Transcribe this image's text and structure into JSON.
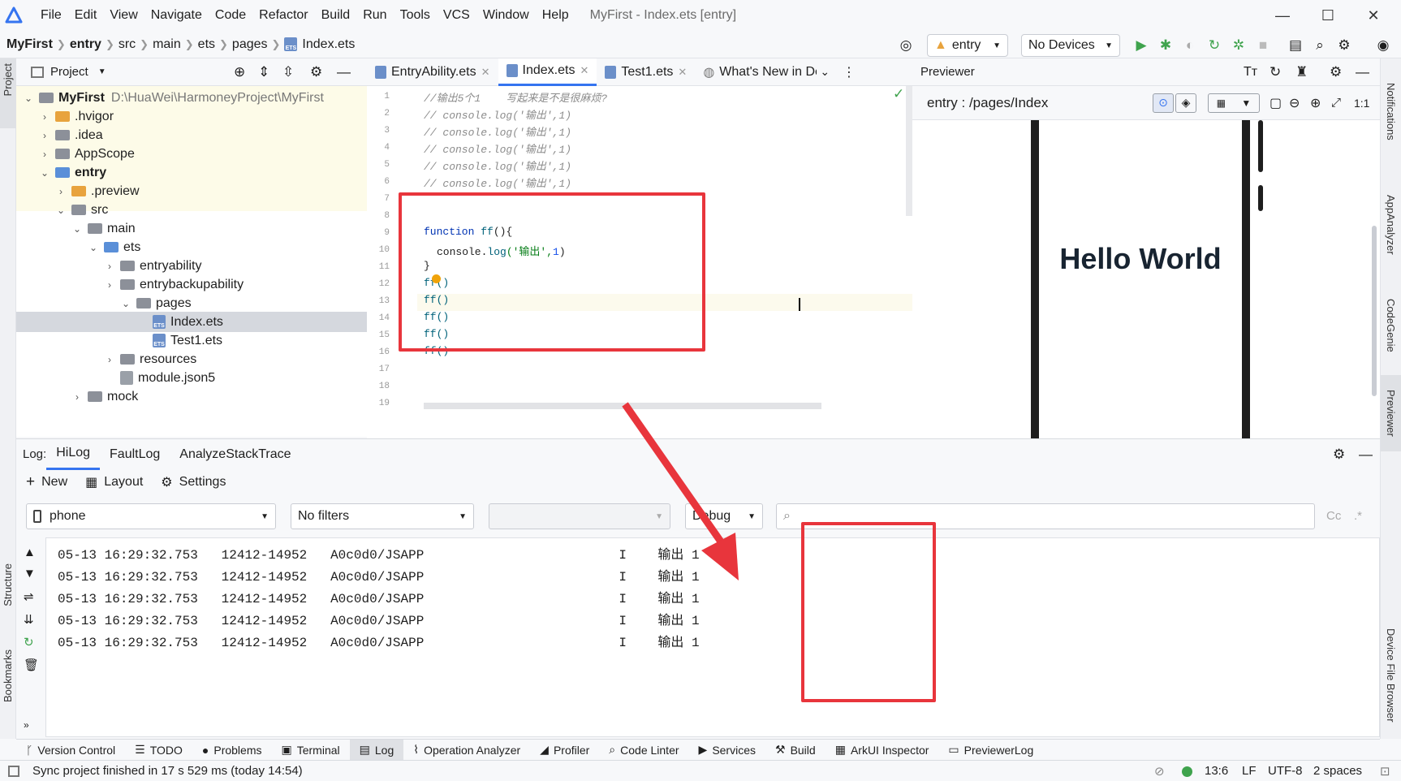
{
  "app": {
    "title": "MyFirst - Index.ets [entry]"
  },
  "menu": [
    "File",
    "Edit",
    "View",
    "Navigate",
    "Code",
    "Refactor",
    "Build",
    "Run",
    "Tools",
    "VCS",
    "Window",
    "Help"
  ],
  "breadcrumb": [
    "MyFirst",
    "entry",
    "src",
    "main",
    "ets",
    "pages",
    "Index.ets"
  ],
  "toolbar": {
    "module": "entry",
    "device": "No Devices"
  },
  "project_panel": {
    "title": "Project"
  },
  "tree": [
    {
      "label": "MyFirst",
      "path": "D:\\HuaWei\\HarmoneyProject\\MyFirst"
    },
    {
      "label": ".hvigor"
    },
    {
      "label": ".idea"
    },
    {
      "label": "AppScope"
    },
    {
      "label": "entry"
    },
    {
      "label": ".preview"
    },
    {
      "label": "src"
    },
    {
      "label": "main"
    },
    {
      "label": "ets"
    },
    {
      "label": "entryability"
    },
    {
      "label": "entrybackupability"
    },
    {
      "label": "pages"
    },
    {
      "label": "Index.ets"
    },
    {
      "label": "Test1.ets"
    },
    {
      "label": "resources"
    },
    {
      "label": "module.json5"
    },
    {
      "label": "mock"
    }
  ],
  "editor_tabs": [
    "EntryAbility.ets",
    "Index.ets",
    "Test1.ets",
    "What's New in Dev"
  ],
  "code": {
    "lines": [
      "1",
      "2",
      "3",
      "4",
      "5",
      "6",
      "7",
      "8",
      "9",
      "10",
      "11",
      "12",
      "13",
      "14",
      "15",
      "16",
      "17",
      "18",
      "19"
    ],
    "l1": "//输出5个1    写起来是不是很麻烦?",
    "l2": "// console.log('输出',1)",
    "l9_kw": "function",
    "l9_fn": "ff",
    "l9_rest": "(){",
    "l10_a": "console.",
    "l10_b": "log",
    "l10_c": "('输出',",
    "l10_d": "1",
    ")": ")",
    "l11": "}",
    "call": "ff()"
  },
  "previewer": {
    "title": "Previewer",
    "path": "entry : /pages/Index",
    "hello": "Hello World"
  },
  "log": {
    "label": "Log:",
    "tabs": [
      "HiLog",
      "FaultLog",
      "AnalyzeStackTrace"
    ],
    "tools": [
      "New",
      "Layout",
      "Settings"
    ],
    "filter_device": "phone",
    "filter_mode": "No filters",
    "filter_level": "Debug",
    "rows": [
      {
        "time": "05-13 16:29:32.753",
        "pid": "12412-14952",
        "tag": "A0c0d0/JSAPP",
        "level": "I",
        "msg": "输出 1"
      },
      {
        "time": "05-13 16:29:32.753",
        "pid": "12412-14952",
        "tag": "A0c0d0/JSAPP",
        "level": "I",
        "msg": "输出 1"
      },
      {
        "time": "05-13 16:29:32.753",
        "pid": "12412-14952",
        "tag": "A0c0d0/JSAPP",
        "level": "I",
        "msg": "输出 1"
      },
      {
        "time": "05-13 16:29:32.753",
        "pid": "12412-14952",
        "tag": "A0c0d0/JSAPP",
        "level": "I",
        "msg": "输出 1"
      },
      {
        "time": "05-13 16:29:32.753",
        "pid": "12412-14952",
        "tag": "A0c0d0/JSAPP",
        "level": "I",
        "msg": "输出 1"
      }
    ]
  },
  "side_right": [
    "Notifications",
    "AppAnalyzer",
    "CodeGenie",
    "Previewer",
    "Device File Browser"
  ],
  "side_left": [
    "Project",
    "Structure",
    "Bookmarks"
  ],
  "tool_windows": [
    "Version Control",
    "TODO",
    "Problems",
    "Terminal",
    "Log",
    "Operation Analyzer",
    "Profiler",
    "Code Linter",
    "Services",
    "Build",
    "ArkUI Inspector",
    "PreviewerLog"
  ],
  "status": {
    "message": "Sync project finished in 17 s 529 ms (today 14:54)",
    "position": "13:6",
    "line_sep": "LF",
    "encoding": "UTF-8",
    "indent": "2 spaces"
  },
  "colors": {
    "accent": "#3574f0",
    "annotation": "#e8353c",
    "run": "#3fa34d"
  }
}
